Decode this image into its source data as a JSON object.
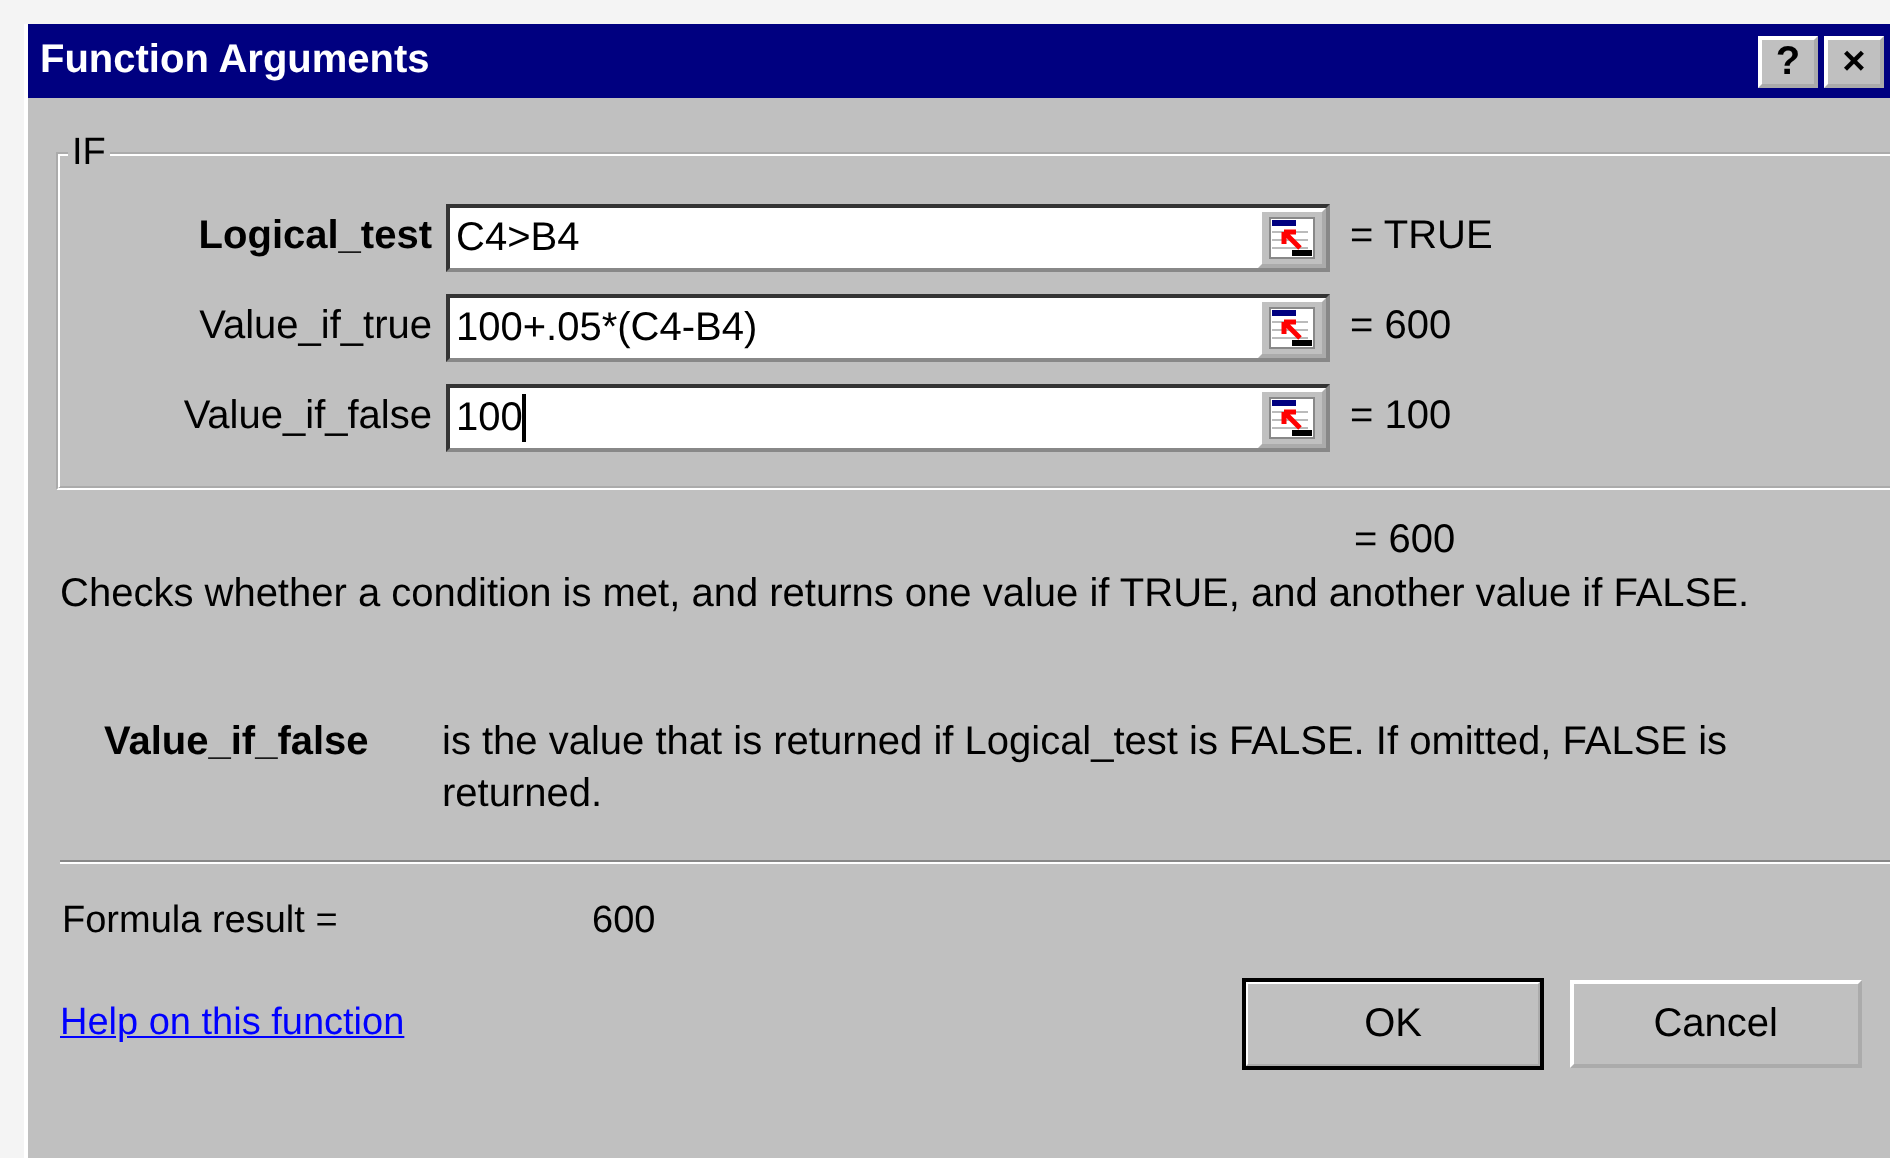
{
  "window": {
    "title": "Function Arguments",
    "buttons": [
      "?",
      "×"
    ]
  },
  "group": {
    "title": "IF",
    "arguments": [
      {
        "label": "Logical_test",
        "required": true,
        "value": "C4>B4",
        "focused": false,
        "result": "= TRUE"
      },
      {
        "label": "Value_if_true",
        "required": false,
        "value": "100+.05*(C4-B4)",
        "focused": false,
        "result": "= 600"
      },
      {
        "label": "Value_if_false",
        "required": false,
        "value": "100",
        "focused": true,
        "result": "= 100"
      }
    ]
  },
  "function_result": "= 600",
  "description": "Checks whether a condition is met, and returns one value if TRUE, and another value if FALSE.",
  "argument_help": {
    "name": "Value_if_false",
    "text": "is the value that is returned if Logical_test is FALSE. If omitted, FALSE is returned."
  },
  "formula_result": {
    "label": "Formula result =",
    "value": "600"
  },
  "help_link": "Help on this function",
  "buttons": [
    "OK",
    "Cancel"
  ]
}
